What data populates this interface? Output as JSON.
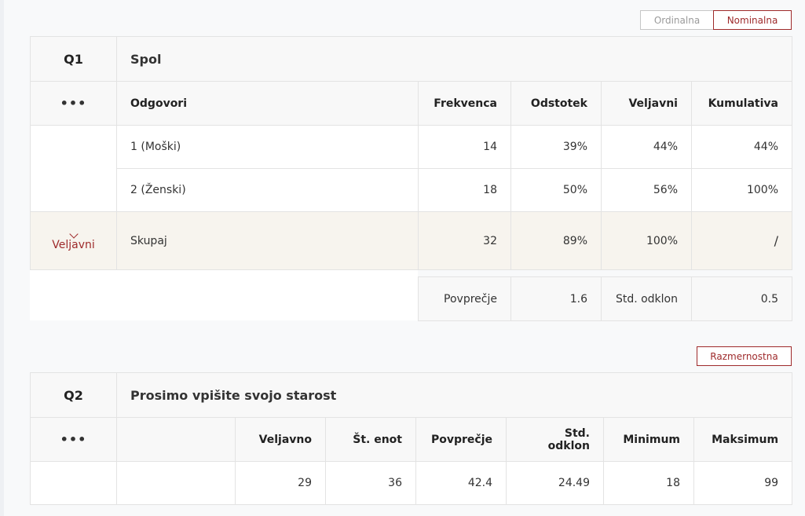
{
  "q1": {
    "toggle_ordinal": "Ordinalna",
    "toggle_nominal": "Nominalna",
    "id": "Q1",
    "title": "Spol",
    "menu": "•••",
    "headers": {
      "answers": "Odgovori",
      "frequency": "Frekvenca",
      "percent": "Odstotek",
      "valid": "Veljavni",
      "cumulative": "Kumulativa"
    },
    "rows": [
      {
        "label": "1 (Moški)",
        "frequency": "14",
        "percent": "39%",
        "valid": "44%",
        "cumulative": "44%"
      },
      {
        "label": "2 (Ženski)",
        "frequency": "18",
        "percent": "50%",
        "valid": "56%",
        "cumulative": "100%"
      }
    ],
    "total": {
      "group_label": "Veljavni",
      "label": "Skupaj",
      "frequency": "32",
      "percent": "89%",
      "valid": "100%",
      "cumulative": "/"
    },
    "stats": {
      "mean_label": "Povprečje",
      "mean_value": "1.6",
      "sd_label": "Std. odklon",
      "sd_value": "0.5"
    }
  },
  "q2": {
    "toggle_ratio": "Razmernostna",
    "id": "Q2",
    "title": "Prosimo vpišite svojo starost",
    "menu": "•••",
    "headers": {
      "valid": "Veljavno",
      "units": "Št. enot",
      "mean": "Povprečje",
      "sd": "Std. odklon",
      "min": "Minimum",
      "max": "Maksimum"
    },
    "row": {
      "valid": "29",
      "units": "36",
      "mean": "42.4",
      "sd": "24.49",
      "min": "18",
      "max": "99"
    }
  }
}
